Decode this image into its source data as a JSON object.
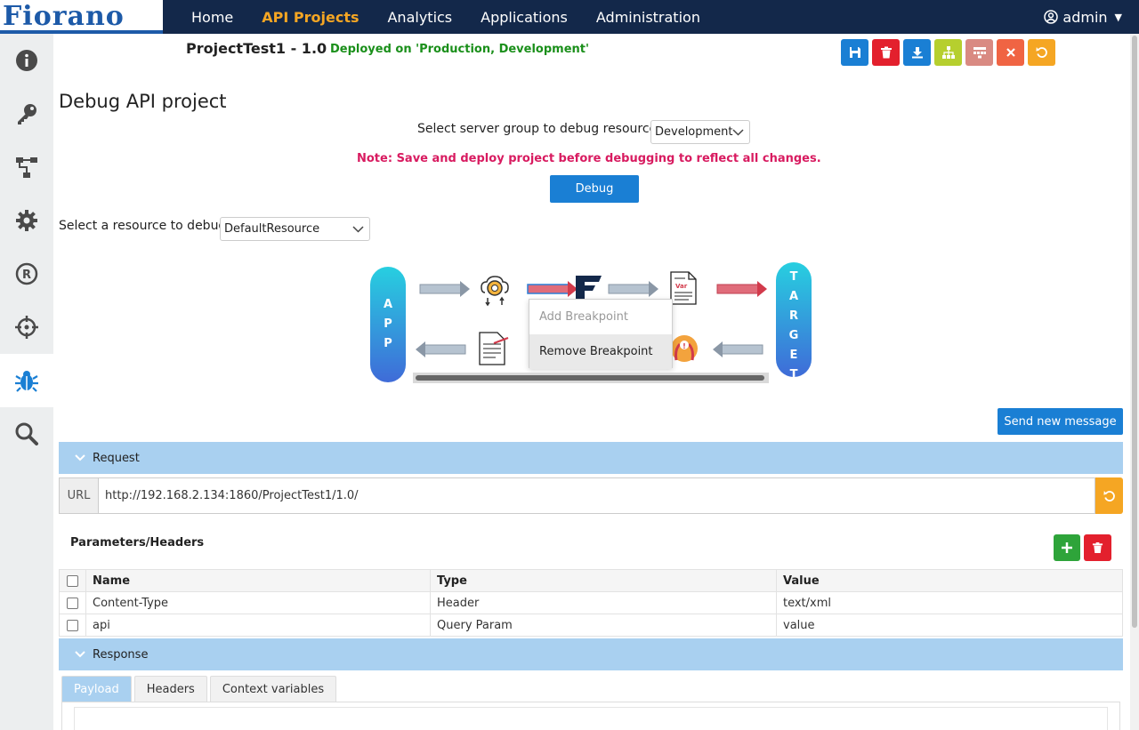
{
  "app": {
    "logo_text": "Fiorano"
  },
  "nav": {
    "items": [
      {
        "label": "Home",
        "active": false
      },
      {
        "label": "API Projects",
        "active": true
      },
      {
        "label": "Analytics",
        "active": false
      },
      {
        "label": "Applications",
        "active": false
      },
      {
        "label": "Administration",
        "active": false
      }
    ],
    "user": "admin"
  },
  "sidebar": {
    "items": [
      {
        "icon": "info-icon",
        "active": false
      },
      {
        "icon": "key-icon",
        "active": false
      },
      {
        "icon": "flow-icon",
        "active": false
      },
      {
        "icon": "gear-icon",
        "active": false
      },
      {
        "icon": "registered-icon",
        "active": false
      },
      {
        "icon": "crosshair-icon",
        "active": false
      },
      {
        "icon": "bug-icon",
        "active": true
      },
      {
        "icon": "search-icon",
        "active": false
      }
    ]
  },
  "project": {
    "title": "ProjectTest1 - 1.0",
    "status": "Deployed on 'Production, Development'"
  },
  "toolbar": {
    "buttons": [
      {
        "name": "save",
        "color": "#1a7fd4",
        "icon": "save-icon"
      },
      {
        "name": "delete",
        "color": "#e3202d",
        "icon": "trash-icon"
      },
      {
        "name": "download",
        "color": "#1a7fd4",
        "icon": "download-icon"
      },
      {
        "name": "deploy",
        "color": "#b6cf2e",
        "icon": "hierarchy-icon"
      },
      {
        "name": "undeploy",
        "color": "#d98a82",
        "icon": "hierarchy-off-icon"
      },
      {
        "name": "close",
        "color": "#f06443",
        "icon": "close-icon"
      },
      {
        "name": "refresh",
        "color": "#f5a623",
        "icon": "refresh-icon"
      }
    ]
  },
  "debug": {
    "heading": "Debug API project",
    "server_group_label": "Select server group to debug resources",
    "server_group_value": "Development",
    "note": "Note: Save and deploy project before debugging to reflect all changes.",
    "debug_button": "Debug",
    "resource_label": "Select a resource to debug",
    "resource_value": "DefaultResource"
  },
  "flow": {
    "app_letters": [
      "A",
      "P",
      "P"
    ],
    "target_letters": [
      "T",
      "A",
      "R",
      "G",
      "E",
      "T"
    ],
    "context_menu": {
      "add": "Add Breakpoint",
      "remove": "Remove Breakpoint"
    }
  },
  "send_button": "Send new message",
  "request": {
    "title": "Request",
    "url_label": "URL",
    "url_value": "http://192.168.2.134:1860/ProjectTest1/1.0/",
    "params_label": "Parameters/Headers",
    "columns": [
      "Name",
      "Type",
      "Value"
    ],
    "rows": [
      {
        "name": "Content-Type",
        "type": "Header",
        "value": "text/xml"
      },
      {
        "name": "api",
        "type": "Query Param",
        "value": "value"
      }
    ]
  },
  "response": {
    "title": "Response",
    "tabs": [
      {
        "label": "Payload",
        "active": true
      },
      {
        "label": "Headers",
        "active": false
      },
      {
        "label": "Context variables",
        "active": false
      }
    ]
  }
}
